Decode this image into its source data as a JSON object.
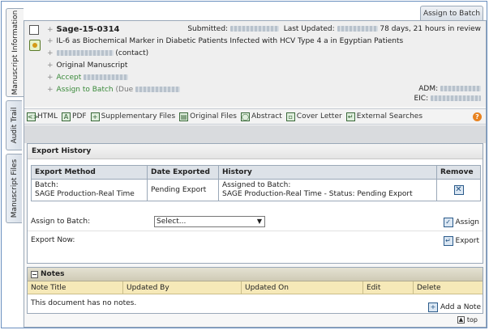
{
  "top_tab": {
    "label": "Assign to Batch"
  },
  "side_tabs": [
    {
      "label": "Manuscript Information"
    },
    {
      "label": "Audit Trail"
    },
    {
      "label": "Manuscript Files"
    }
  ],
  "header": {
    "manuscript_id": "Sage-15-0314",
    "title": "IL-6 as Biochemical Marker in Diabetic Patients Infected with HCV Type 4 a in Egyptian Patients",
    "contact_suffix": "(contact)",
    "original_manuscript": "Original Manuscript",
    "accept_label": "Accept",
    "assign_label": "Assign to Batch",
    "due_label": "(Due",
    "submitted_label": "Submitted:",
    "last_updated_label": "Last Updated:",
    "elapsed": "78 days, 21 hours in review",
    "adm_label": "ADM:",
    "eic_label": "EIC:"
  },
  "toolbar": {
    "html": "HTML",
    "pdf": "PDF",
    "supplementary": "Supplementary Files",
    "original_files": "Original Files",
    "abstract": "Abstract",
    "cover_letter": "Cover Letter",
    "external_searches": "External Searches",
    "help": "?"
  },
  "export_history": {
    "title": "Export History",
    "columns": [
      "Export Method",
      "Date Exported",
      "History",
      "Remove"
    ],
    "rows": [
      {
        "method_line1": "Batch:",
        "method_line2": "SAGE Production-Real Time",
        "date_exported": "Pending Export",
        "history_line1": "Assigned to Batch:",
        "history_line2": "SAGE Production-Real Time - Status: Pending Export"
      }
    ],
    "assign_to_batch_label": "Assign to Batch:",
    "select_value": "Select...",
    "assign_button": "Assign",
    "export_now_label": "Export Now:",
    "export_button": "Export"
  },
  "notes": {
    "title": "Notes",
    "columns": [
      "Note Title",
      "Updated By",
      "Updated On",
      "Edit",
      "Delete"
    ],
    "empty_message": "This document has no notes.",
    "add_button": "Add a Note"
  },
  "top_link": "top"
}
